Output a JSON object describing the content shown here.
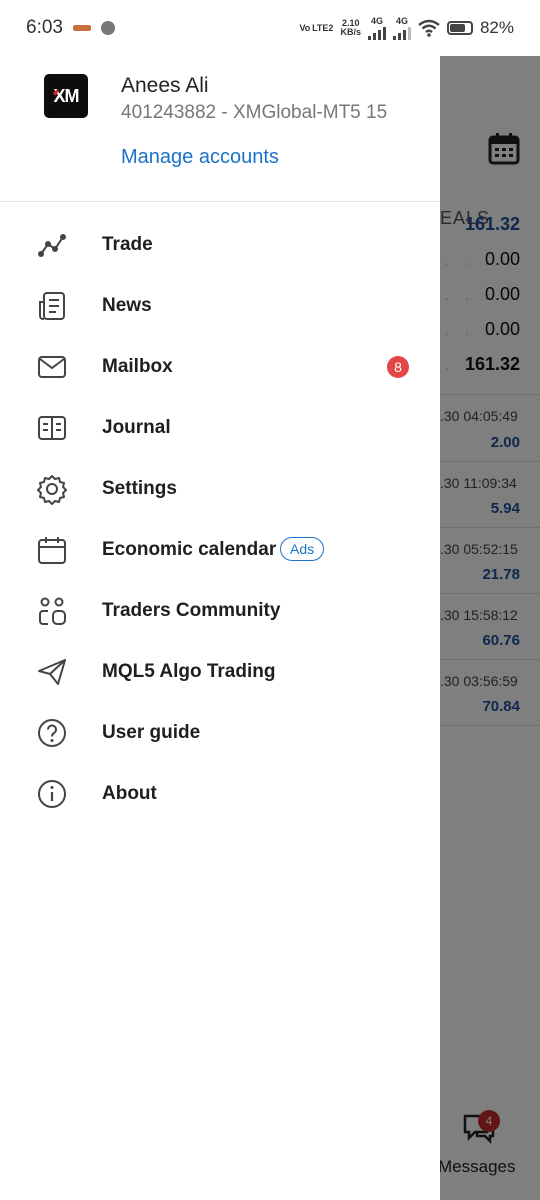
{
  "status_bar": {
    "time": "6:03",
    "net_label_top": "Vo LTE2",
    "net_speed": "2.10",
    "net_speed_unit": "KB/s",
    "sig1": "4G",
    "sig2": "4G",
    "battery_pct": "82%",
    "battery_level": 0.82
  },
  "account": {
    "logo_text": "XM",
    "name": "Anees Ali",
    "id_line": "401243882 - XMGlobal-MT5 15",
    "manage_label": "Manage accounts"
  },
  "menu": [
    {
      "label": "Trade",
      "icon": "trend-line-icon"
    },
    {
      "label": "News",
      "icon": "news-icon"
    },
    {
      "label": "Mailbox",
      "icon": "mail-icon",
      "badge": "8"
    },
    {
      "label": "Journal",
      "icon": "journal-icon"
    },
    {
      "label": "Settings",
      "icon": "gear-icon"
    },
    {
      "label": "Economic calendar",
      "icon": "calendar-icon",
      "tag": "Ads"
    },
    {
      "label": "Traders Community",
      "icon": "community-icon"
    },
    {
      "label": "MQL5 Algo Trading",
      "icon": "send-icon"
    },
    {
      "label": "User guide",
      "icon": "help-icon"
    },
    {
      "label": "About",
      "icon": "info-icon"
    }
  ],
  "background": {
    "tab_partial": "EALS",
    "summary_values": [
      "161.32",
      "0.00",
      "0.00",
      "0.00",
      "161.32"
    ],
    "deals": [
      {
        "time": ".30 04:05:49",
        "value": "2.00"
      },
      {
        "time": ".30 11:09:34",
        "value": "5.94"
      },
      {
        "time": ".30 05:52:15",
        "value": "21.78"
      },
      {
        "time": ".30 15:58:12",
        "value": "60.76"
      },
      {
        "time": ".30 03:56:59",
        "value": "70.84"
      }
    ],
    "messages_label": "Messages",
    "messages_badge": "4"
  }
}
